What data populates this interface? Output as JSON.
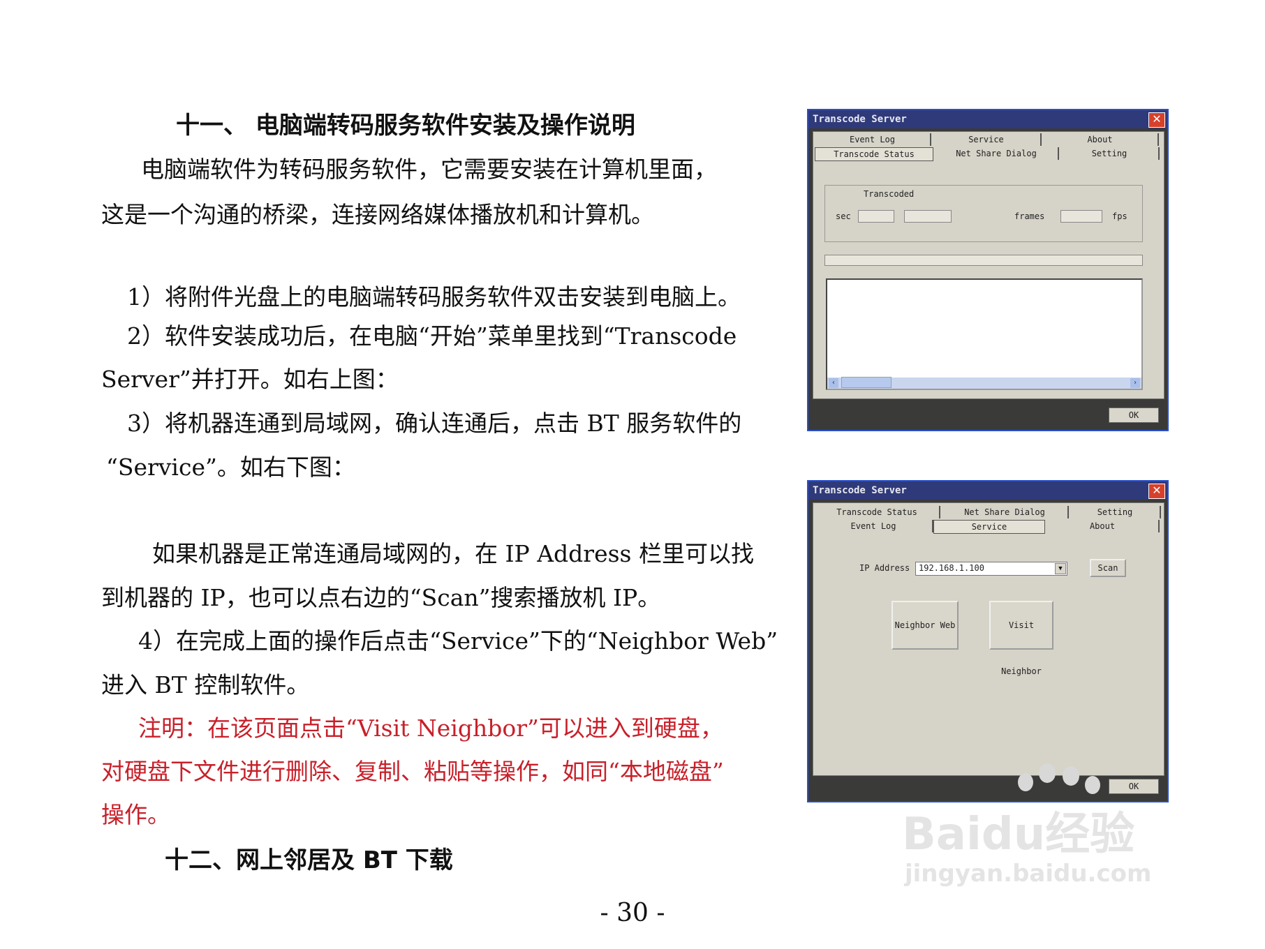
{
  "heading_11": "十一、  电脑端转码服务软件安装及操作说明",
  "paragraphs": {
    "p1_line1": "电脑端软件为转码服务软件，它需要安装在计算机里面，",
    "p1_line2": "这是一个沟通的桥梁，连接网络媒体播放机和计算机。",
    "s1": "1）将附件光盘上的电脑端转码服务软件双击安装到电脑上。",
    "s2_line1": "2）软件安装成功后，在电脑“开始”菜单里找到“Transcode",
    "s2_line2": "Server”并打开。如右上图：",
    "s3_line1": "3）将机器连通到局域网，确认连通后，点击 BT 服务软件的",
    "s3_line2": "“Service”。如右下图：",
    "p2_line1": "如果机器是正常连通局域网的，在 IP Address 栏里可以找",
    "p2_line2": "到机器的 IP，也可以点右边的“Scan”搜索播放机 IP。",
    "s4_line1": "4）在完成上面的操作后点击“Service”下的“Neighbor Web”",
    "s4_line2": "进入 BT 控制软件。",
    "note_line1": "注明：在该页面点击“Visit    Neighbor”可以进入到硬盘，",
    "note_line2": "对硬盘下文件进行删除、复制、粘贴等操作，如同“本地磁盘”",
    "note_line3": "操作。"
  },
  "heading_12": "十二、网上邻居及 BT 下载",
  "page_number": "- 30 -",
  "window1": {
    "title": "Transcode Server",
    "close_glyph": "✕",
    "tabs_row1": [
      "Event Log",
      "Service",
      "About"
    ],
    "tabs_row2": [
      "Transcode Status",
      "Net Share Dialog",
      "Setting"
    ],
    "group_label": "Transcoded",
    "sec_label": "sec",
    "frames_label": "frames",
    "fps_label": "fps",
    "ok": "OK"
  },
  "window2": {
    "title": "Transcode Server",
    "close_glyph": "✕",
    "tabs_row1": [
      "Transcode Status",
      "Net Share Dialog",
      "Setting"
    ],
    "tabs_row2": [
      "Event Log",
      "Service",
      "About"
    ],
    "ip_label": "IP Address",
    "ip_value": "192.168.1.100",
    "scan": "Scan",
    "neighbor_web": "Neighbor Web",
    "visit_neighbor": "Visit Neighbor",
    "ok": "OK"
  },
  "watermark": {
    "brand": "Baidu经验",
    "url": "jingyan.baidu.com"
  }
}
